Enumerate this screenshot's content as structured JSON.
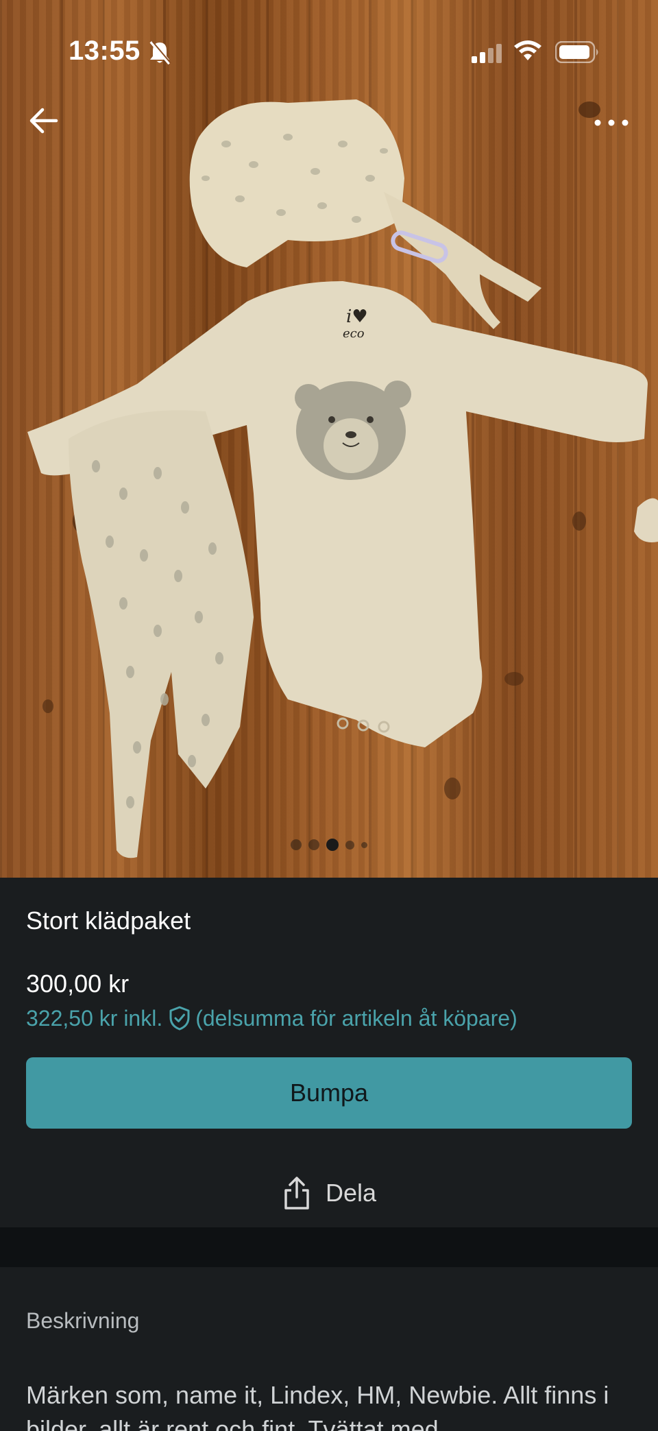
{
  "status_bar": {
    "time": "13:55"
  },
  "gallery": {
    "image_count": 5,
    "active_index": 2
  },
  "listing": {
    "title": "Stort klädpaket",
    "price": "300,00 kr",
    "price_incl": "322,50 kr inkl.",
    "price_incl_note": "(delsumma för artikeln åt köpare)"
  },
  "actions": {
    "bump_label": "Bumpa",
    "share_label": "Dela"
  },
  "description": {
    "heading": "Beskrivning",
    "text": "Märken som, name it, Lindex, HM, Newbie. Allt finns i bilder, allt är rent och fint. Tvättat med"
  },
  "colors": {
    "accent": "#4199a3",
    "accent_text": "#4aa3ab",
    "background": "#1a1d1f"
  }
}
